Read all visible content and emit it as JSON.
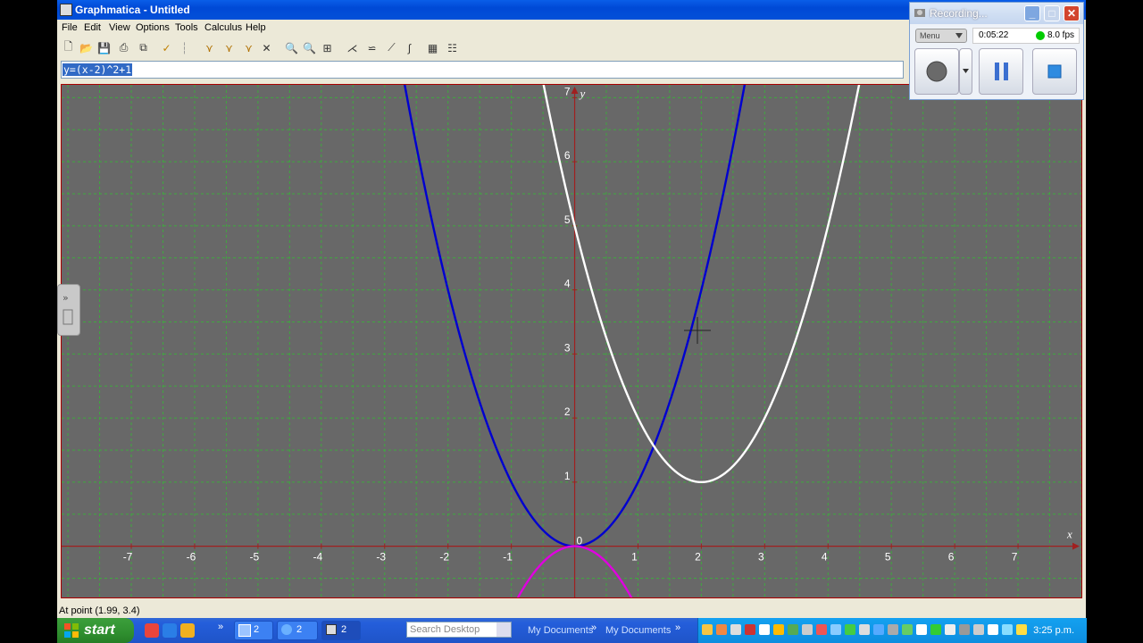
{
  "window": {
    "title": "Graphmatica - Untitled"
  },
  "menu": [
    "File",
    "Edit",
    "View",
    "Options",
    "Tools",
    "Calculus",
    "Help"
  ],
  "equation": {
    "value": "y=(x-2)^2+1"
  },
  "graph": {
    "x_axis_label": "x",
    "y_axis_label": "y",
    "x_ticks": [
      "-7",
      "-6",
      "-5",
      "-4",
      "-3",
      "-2",
      "-1",
      "0",
      "1",
      "2",
      "3",
      "4",
      "5",
      "6",
      "7"
    ],
    "y_ticks": [
      "1",
      "2",
      "3",
      "4",
      "5",
      "6",
      "7"
    ],
    "origin_label": "0",
    "xlim": [
      -8.1,
      8.0
    ],
    "ylim": [
      -0.8,
      7.2
    ],
    "grid": true,
    "background": "#686868",
    "curves": [
      {
        "equation": "y=x^2",
        "color": "#0000d0"
      },
      {
        "equation": "y=(x-2)^2+1",
        "color": "#ffffff"
      },
      {
        "equation": "y=-x^2",
        "color": "#e000e0"
      }
    ]
  },
  "status": {
    "text": "At point (1.99, 3.4)"
  },
  "recorder": {
    "title": "Recording...",
    "menu_label": "Menu",
    "elapsed": "0:05:22",
    "fps": "8.0 fps",
    "indicator_color": "#00cc00"
  },
  "taskbar": {
    "start_label": "start",
    "buttons": [
      {
        "label": "2",
        "icon": "notepad-icon"
      },
      {
        "label": "2",
        "icon": "ie-icon"
      },
      {
        "label": "2",
        "icon": "graphmatica-icon"
      }
    ],
    "search_placeholder": "Search Desktop",
    "toolbars": [
      "My Documents",
      "My Documents"
    ],
    "clock": "3:25 p.m."
  }
}
